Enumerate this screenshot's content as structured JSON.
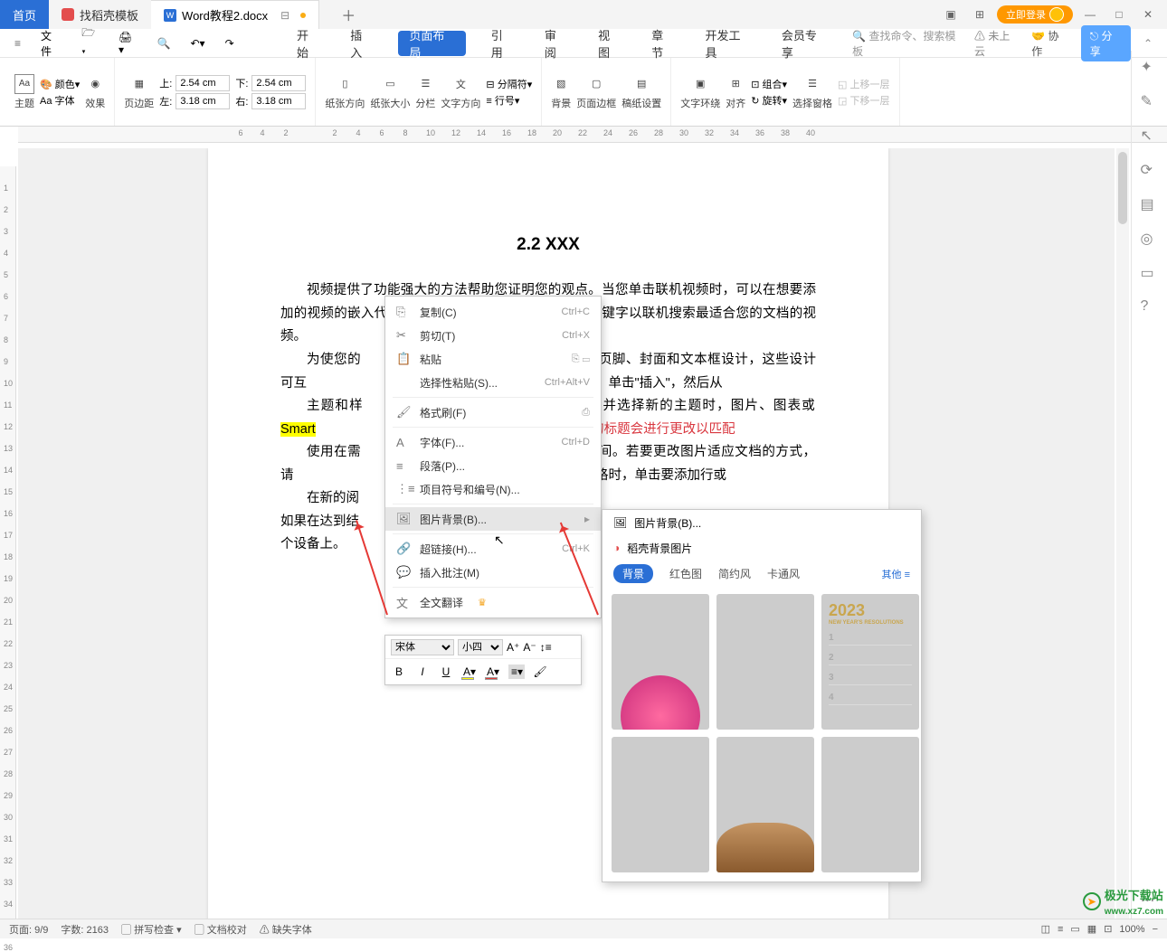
{
  "titlebar": {
    "home_tab": "首页",
    "template_tab": "找稻壳模板",
    "doc_tab": "Word教程2.docx",
    "login": "立即登录"
  },
  "qat": {
    "file_label": "文件"
  },
  "menu": {
    "items": [
      "开始",
      "插入",
      "页面布局",
      "引用",
      "审阅",
      "视图",
      "章节",
      "开发工具",
      "会员专享"
    ],
    "active_index": 2,
    "search_placeholder": "查找命令、搜索模板",
    "cloud": "未上云",
    "collab": "协作",
    "share": "分享"
  },
  "ribbon": {
    "theme": "主题",
    "color": "颜色",
    "font": "Aa 字体",
    "effect": "效果",
    "margin": "页边距",
    "top": "上:",
    "top_v": "2.54 cm",
    "bottom": "下:",
    "bottom_v": "2.54 cm",
    "left": "左:",
    "left_v": "3.18 cm",
    "right": "右:",
    "right_v": "3.18 cm",
    "orientation": "纸张方向",
    "size": "纸张大小",
    "columns": "分栏",
    "textdir": "文字方向",
    "separator": "分隔符",
    "lineno": "行号",
    "background": "背景",
    "border": "页面边框",
    "gutter": "稿纸设置",
    "wrap": "文字环绕",
    "align": "对齐",
    "rotate": "旋转",
    "group": "组合",
    "selpane": "选择窗格",
    "bringfwd": "上移一层",
    "sendback": "下移一层"
  },
  "doc": {
    "heading": "2.2 XXX",
    "p1": "视频提供了功能强大的方法帮助您证明您的观点。当您单击联机视频时，可以在想要添加的视频的嵌入代码中进行粘贴。您也可以键入一个关键字以联机搜索最适合您的文档的视频。",
    "p2a": "为使您的",
    "p2b": "眉、页脚、封面和文本框设计，这些设计可互",
    "p2c": "面、页眉和提要栏。单击\"插入\"，然后从",
    "p3a": "主题和样",
    "p3b": "设计并选择新的主题时，图片、图表或 ",
    "p3_hl": "Smart",
    "p3_red": "当应用样式时，您的标题会进行更改以匹配",
    "p4": "使用在需",
    "p4b": "字时间。若要更改图片适应文档的方式，请",
    "p4c": "选项按钮。当处理表格时，单击要添加行或",
    "p5": "在新的阅",
    "p5b": "如果在达到结",
    "p5c": "个设备上。"
  },
  "ctx": {
    "copy": "复制(C)",
    "copy_sc": "Ctrl+C",
    "cut": "剪切(T)",
    "cut_sc": "Ctrl+X",
    "paste": "粘贴",
    "paste_special": "选择性粘贴(S)...",
    "paste_special_sc": "Ctrl+Alt+V",
    "format_painter": "格式刷(F)",
    "font": "字体(F)...",
    "font_sc": "Ctrl+D",
    "paragraph": "段落(P)...",
    "bullets": "项目符号和编号(N)...",
    "picbg": "图片背景(B)...",
    "hyperlink": "超链接(H)...",
    "hyperlink_sc": "Ctrl+K",
    "comment": "插入批注(M)",
    "translate": "全文翻译"
  },
  "submenu": {
    "picbg": "图片背景(B)...",
    "source": "稻壳背景图片",
    "tabs": [
      "背景",
      "红色图",
      "简约风",
      "卡通风"
    ],
    "other": "其他",
    "year": "2023",
    "year_sub": "NEW YEAR'S RESOLUTIONS"
  },
  "mini": {
    "font": "宋体",
    "size": "小四"
  },
  "status": {
    "page": "页面: 9/9",
    "words": "字数: 2163",
    "spell": "拼写检查",
    "proof": "文档校对",
    "missing": "缺失字体",
    "zoom": "100%"
  },
  "watermark": {
    "site": "极光下载站",
    "url": "www.xz7.com"
  }
}
